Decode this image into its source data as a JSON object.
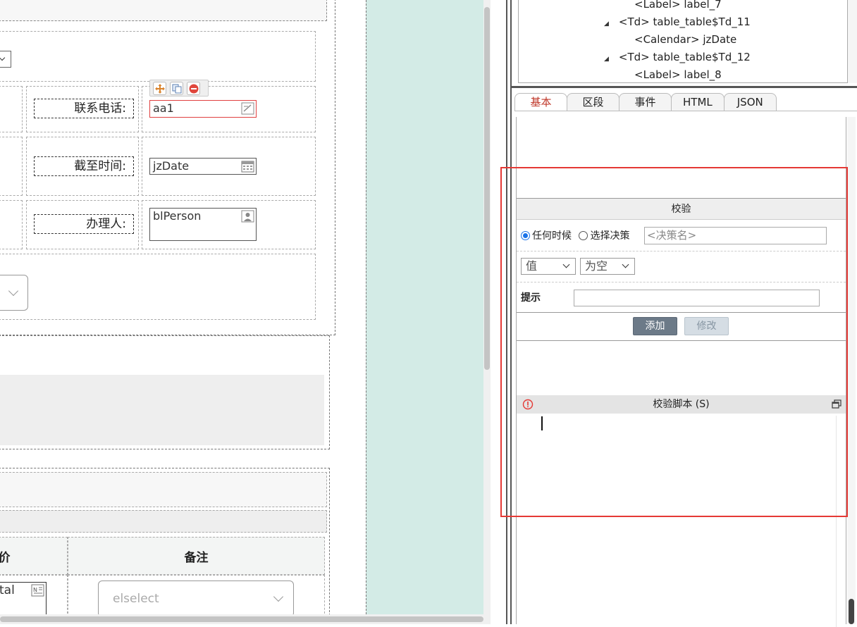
{
  "form": {
    "label_phone": "联系电话:",
    "label_deadline": "截至时间:",
    "label_handler": "办理人:",
    "field_phone": "aa1",
    "field_deadline": "jzDate",
    "field_handler": "blPerson",
    "col_remark_header": "备注",
    "col_price_header_fragment": "价",
    "cell_total_fragment": "tal",
    "remark_select_placeholder": "elselect"
  },
  "tree": {
    "items": [
      {
        "label": "<Label> label_7"
      },
      {
        "label": "<Td> table_table$Td_11",
        "expander": "◢"
      },
      {
        "label": "<Calendar> jzDate"
      },
      {
        "label": "<Td> table_table$Td_12",
        "expander": "◢"
      },
      {
        "label": "<Label> label_8"
      }
    ]
  },
  "tabs": [
    {
      "label": "基本",
      "active": true
    },
    {
      "label": "区段",
      "active": false
    },
    {
      "label": "事件",
      "active": false
    },
    {
      "label": "HTML",
      "active": false
    },
    {
      "label": "JSON",
      "active": false
    }
  ],
  "validation": {
    "section_title": "校验",
    "radio_any_time": "任何时候",
    "radio_choose_decision": "选择决策",
    "decision_placeholder": "<决策名>",
    "value_select": "值",
    "condition_select": "为空",
    "hint_label": "提示",
    "hint_value": "",
    "add_button": "添加",
    "modify_button": "修改",
    "script_title": "校验脚本 (S)"
  },
  "colors": {
    "accent_red": "#e53935",
    "teal_band": "#d3ebe6",
    "tab_active_text": "#c0392b",
    "radio_blue": "#1a73e8",
    "button_primary": "#6c7a88"
  },
  "icons": [
    "move-icon",
    "copy-icon",
    "delete-icon",
    "edit-field-icon",
    "calendar-icon",
    "person-icon",
    "info-icon",
    "restore-window-icon",
    "chevron-down-icon",
    "tree-expander-icon",
    "note-icon"
  ]
}
